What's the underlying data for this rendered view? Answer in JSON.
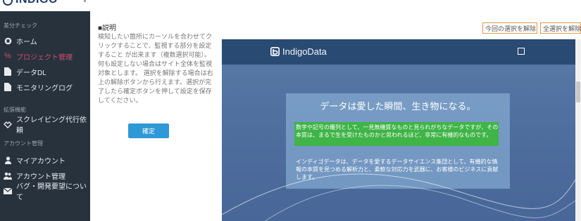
{
  "app": {
    "logo_text": "INDIGO"
  },
  "sidebar": {
    "section1_title": "差分チェック",
    "section2_title": "拡張機能",
    "section3_title": "アカウント管理",
    "items": [
      {
        "label": "ホーム",
        "icon": "home-icon"
      },
      {
        "label": "プロジェクト管理",
        "icon": "project-icon"
      },
      {
        "label": "データDL",
        "icon": "file-icon"
      },
      {
        "label": "モニタリングログ",
        "icon": "log-icon"
      },
      {
        "label": "スクレイピング代行依頼",
        "icon": "handshake-icon"
      },
      {
        "label": "マイアカウント",
        "icon": "user-icon"
      },
      {
        "label": "アカウント管理",
        "icon": "users-icon"
      },
      {
        "label": "バグ・開発要望について",
        "icon": "mail-icon"
      }
    ]
  },
  "main": {
    "desc_title": "■説明",
    "desc_text": "検知したい箇所にカーソルを合わせてクリックすることで、監視する部分を設定すること が出来ます（複数選択可能）。何も設定しない場合はサイト全体を監視対象とします。 選択を解除する場合は右上の解除ボタンから行えます。選択が完了したら確定ボタンを押して設定を保存してください。",
    "confirm_label": "確定",
    "clear_last_label": "今回の選択を解除",
    "clear_all_label": "全選択を解除"
  },
  "preview": {
    "brand_name": "IndigoData",
    "hero_title": "データは愛した瞬間、生き物になる。",
    "paragraph1": "数字や記号の羅列として、一見無機質なものと見られがちなデータですが、その本質は、まるで生を受けたものかと思われるほど、非常に有機的なものです。",
    "paragraph2": "インディゴデータは、データを愛するデータサイエンス集団として、有機的な情報の本質を見つめる解析力と、柔軟な対応力を武器に、お客様のビジネスに貢献します。"
  },
  "colors": {
    "sidebar_bg": "#27323d",
    "active_item": "#d34c6c",
    "primary_button": "#2f98d6",
    "outline_button_border": "#e2984b",
    "highlight_green": "#3fb447",
    "preview_header": "#294a72"
  }
}
